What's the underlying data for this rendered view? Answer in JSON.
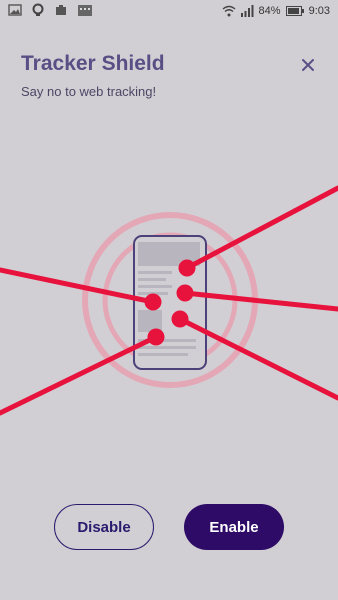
{
  "status_bar": {
    "battery": "84%",
    "time": "9:03",
    "icons": [
      "image-icon",
      "location-icon",
      "puzzle-icon",
      "calendar-icon",
      "wifi-icon",
      "signal-icon",
      "battery-icon"
    ]
  },
  "header": {
    "title": "Tracker Shield",
    "subtitle": "Say no to web tracking!",
    "close_icon": "close-icon"
  },
  "buttons": {
    "disable_label": "Disable",
    "enable_label": "Enable"
  },
  "colors": {
    "background": "#d2cfd4",
    "title": "#5a4f85",
    "tracker_red": "#e8133d",
    "shield_ring": "#e3a7b6",
    "primary_button": "#2d0b66"
  }
}
